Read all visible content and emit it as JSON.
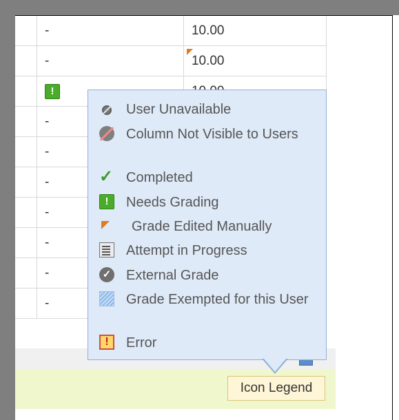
{
  "grid": {
    "rows": [
      {
        "status": "-",
        "grade": "10.00",
        "edited": false
      },
      {
        "status": "-",
        "grade": "10.00",
        "edited": true
      },
      {
        "status": "!",
        "grade": "10.00",
        "edited": false,
        "needs_grading": true
      },
      {
        "status": "-",
        "grade": "",
        "edited": false
      },
      {
        "status": "-",
        "grade": "",
        "edited": false
      },
      {
        "status": "-",
        "grade": "",
        "edited": false
      },
      {
        "status": "-",
        "grade": "",
        "edited": false
      },
      {
        "status": "-",
        "grade": "",
        "edited": false
      },
      {
        "status": "-",
        "grade": "",
        "edited": false
      },
      {
        "status": "-",
        "grade": "",
        "edited": false
      }
    ]
  },
  "legend_popup": {
    "items": [
      {
        "icon": "user-unavailable-icon",
        "label": "User Unavailable"
      },
      {
        "icon": "column-not-visible-icon",
        "label": "Column Not Visible to Users"
      },
      {
        "icon": "completed-check-icon",
        "label": "Completed"
      },
      {
        "icon": "needs-grading-icon",
        "label": "Needs Grading"
      },
      {
        "icon": "grade-edited-flag-icon",
        "label": "Grade Edited Manually"
      },
      {
        "icon": "attempt-in-progress-icon",
        "label": "Attempt in Progress"
      },
      {
        "icon": "external-grade-icon",
        "label": "External Grade"
      },
      {
        "icon": "grade-exempted-icon",
        "label": "Grade Exempted for this User"
      },
      {
        "icon": "error-icon",
        "label": "Error"
      }
    ]
  },
  "footer": {
    "icon_legend_label": "Icon Legend"
  },
  "colors": {
    "popup_bg": "#dfeaf8",
    "popup_border": "#8fb0da",
    "needs_grading_green": "#4bab2a",
    "edited_flag_orange": "#e07b1f",
    "footer_green": "#f0f7cd"
  }
}
